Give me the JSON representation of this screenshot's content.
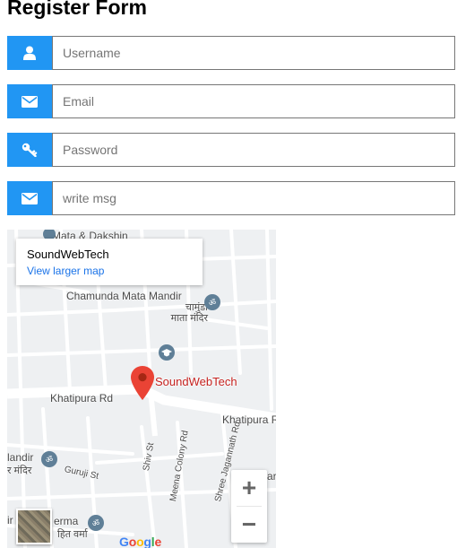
{
  "form": {
    "title": "Register Form",
    "fields": [
      {
        "name": "username",
        "placeholder": "Username",
        "icon": "user-icon"
      },
      {
        "name": "email",
        "placeholder": "Email",
        "icon": "envelope-icon"
      },
      {
        "name": "password",
        "placeholder": "Password",
        "icon": "key-icon"
      },
      {
        "name": "message",
        "placeholder": "write msg",
        "icon": "envelope-icon"
      }
    ],
    "accent_color": "#2196f3"
  },
  "map": {
    "place_name": "SoundWebTech",
    "view_larger": "View larger map",
    "marker_label": "SoundWebTech",
    "labels": {
      "top": "Mata & Dakshin",
      "temple": "Chamunda Mata Mandir",
      "temple_hindi": "चामुंडा\nमाता मंदिर",
      "road1": "Khatipura Rd",
      "road2": "Khatipura R",
      "left_temple": "landir",
      "left_temple_hindi": "र मंदिर",
      "guruji": "Guruji St",
      "shiv": "Shiv St",
      "meena": "Meena Colony Rd",
      "jagannath": "Shree Jagannath Rd",
      "bottom_left": "ir",
      "verma": "erma",
      "verma_hindi": "हित वर्मा",
      "right_edge": "ar"
    },
    "zoom_in": "+",
    "zoom_out": "−",
    "google": [
      "G",
      "o",
      "o",
      "g",
      "l",
      "e"
    ]
  }
}
